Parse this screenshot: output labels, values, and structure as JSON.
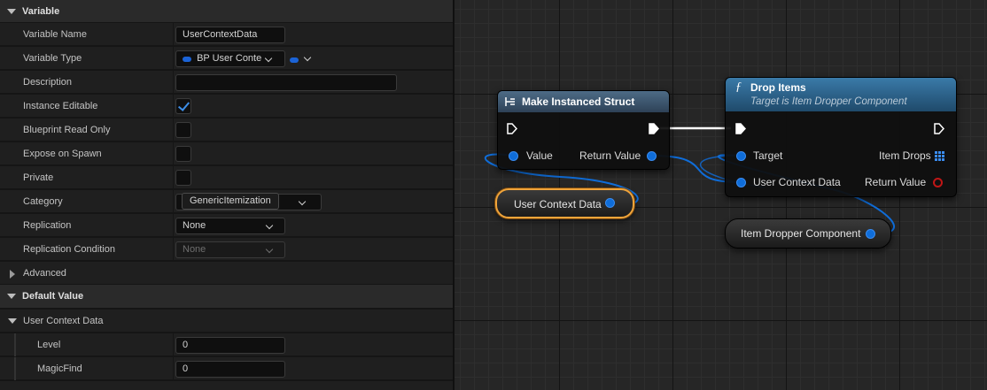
{
  "details": {
    "variable_section": "Variable",
    "variable_name_label": "Variable Name",
    "variable_name_value": "UserContextData",
    "variable_type_label": "Variable Type",
    "variable_type_value": "BP User Conte",
    "description_label": "Description",
    "description_value": "",
    "instance_editable_label": "Instance Editable",
    "instance_editable": true,
    "blueprint_read_only_label": "Blueprint Read Only",
    "blueprint_read_only": false,
    "expose_on_spawn_label": "Expose on Spawn",
    "expose_on_spawn": false,
    "private_label": "Private",
    "private": false,
    "category_label": "Category",
    "category_value": "GenericItemization",
    "replication_label": "Replication",
    "replication_value": "None",
    "replication_condition_label": "Replication Condition",
    "replication_condition_value": "None",
    "advanced_label": "Advanced",
    "default_value_section": "Default Value",
    "user_context_data_label": "User Context Data",
    "level_label": "Level",
    "level_value": "0",
    "magicfind_label": "MagicFind",
    "magicfind_value": "0"
  },
  "graph": {
    "make_struct": {
      "title": "Make Instanced Struct",
      "value_pin": "Value",
      "return_pin": "Return Value"
    },
    "drop_items": {
      "title": "Drop Items",
      "subtitle": "Target is Item Dropper Component",
      "target_pin": "Target",
      "user_context_pin": "User Context Data",
      "item_drops_pin": "Item Drops",
      "return_pin": "Return Value"
    },
    "user_context_var": "User Context Data",
    "item_dropper_var": "Item Dropper Component"
  },
  "colors": {
    "struct_pin": "#0f6dd9",
    "selection": "#f0a43a",
    "make_struct_header": "#3e5a73",
    "function_header": "#2b5f86",
    "return_bool": "#c01616"
  }
}
